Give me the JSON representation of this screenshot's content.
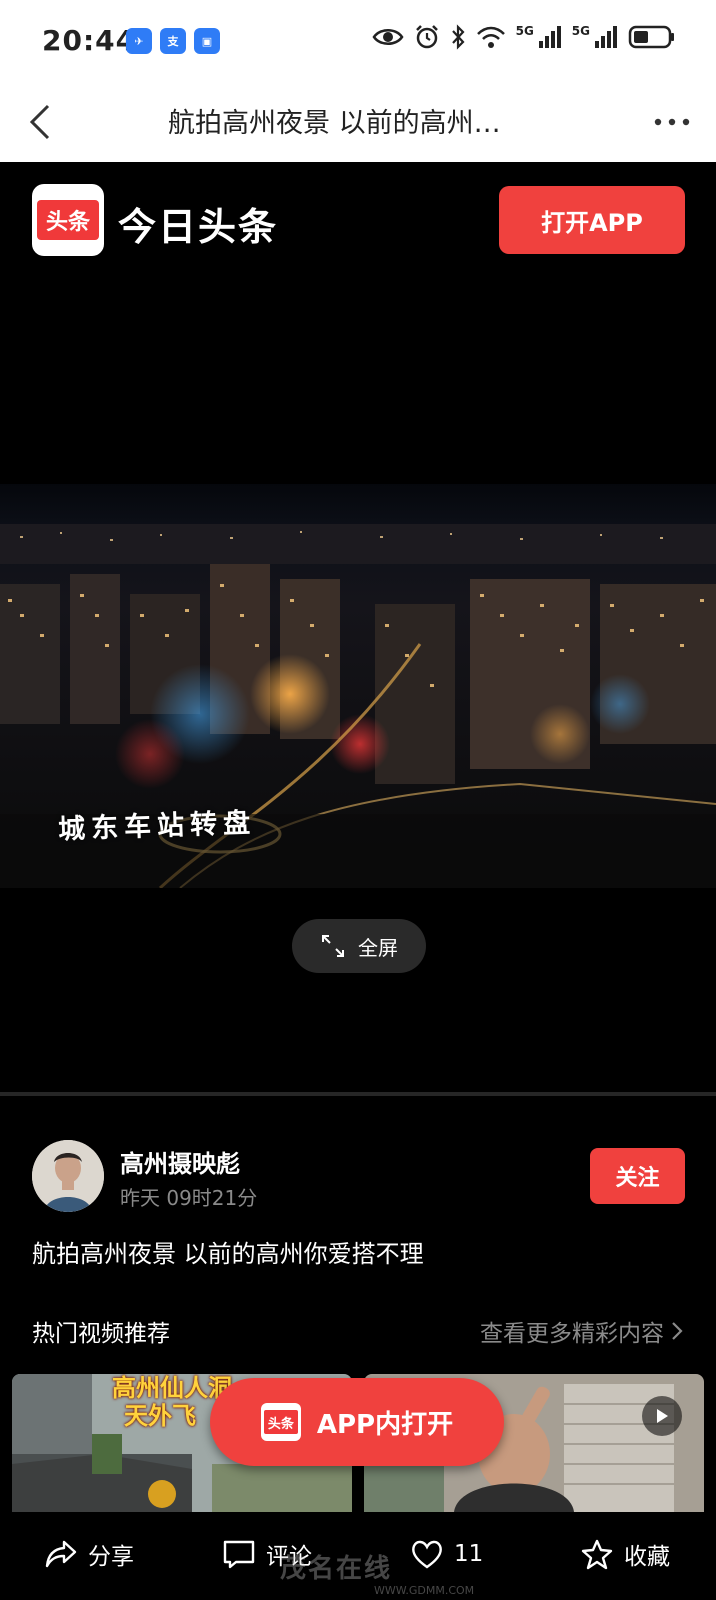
{
  "status_bar": {
    "time": "20:44",
    "app_badges": [
      "",
      "",
      ""
    ],
    "network_1": "5G",
    "network_2": "5G"
  },
  "nav": {
    "title": "航拍高州夜景 以前的高州…"
  },
  "banner": {
    "logo_text": "头条",
    "brand": "今日头条",
    "open_app": "打开APP"
  },
  "video": {
    "caption": "城东车站转盘",
    "fullscreen": "全屏"
  },
  "author": {
    "name": "高州摄映彪",
    "time": "昨天 09时21分",
    "follow": "关注"
  },
  "post": {
    "text": "航拍高州夜景 以前的高州你爱搭不理"
  },
  "recommend": {
    "title": "热门视频推荐",
    "more": "查看更多精彩内容",
    "thumb_left_line1": "高州仙人洞",
    "thumb_left_line2": "天外飞"
  },
  "float_button": {
    "logo_text": "头条",
    "label": "APP内打开"
  },
  "toolbar": {
    "share": "分享",
    "comment": "评论",
    "like_count": "11",
    "favorite": "收藏"
  },
  "watermark": {
    "text": "茂名在线",
    "url": "WWW.GDMM.COM"
  },
  "colors": {
    "accent": "#f0413e",
    "background": "#000000",
    "muted_text": "#8a8a8a"
  }
}
